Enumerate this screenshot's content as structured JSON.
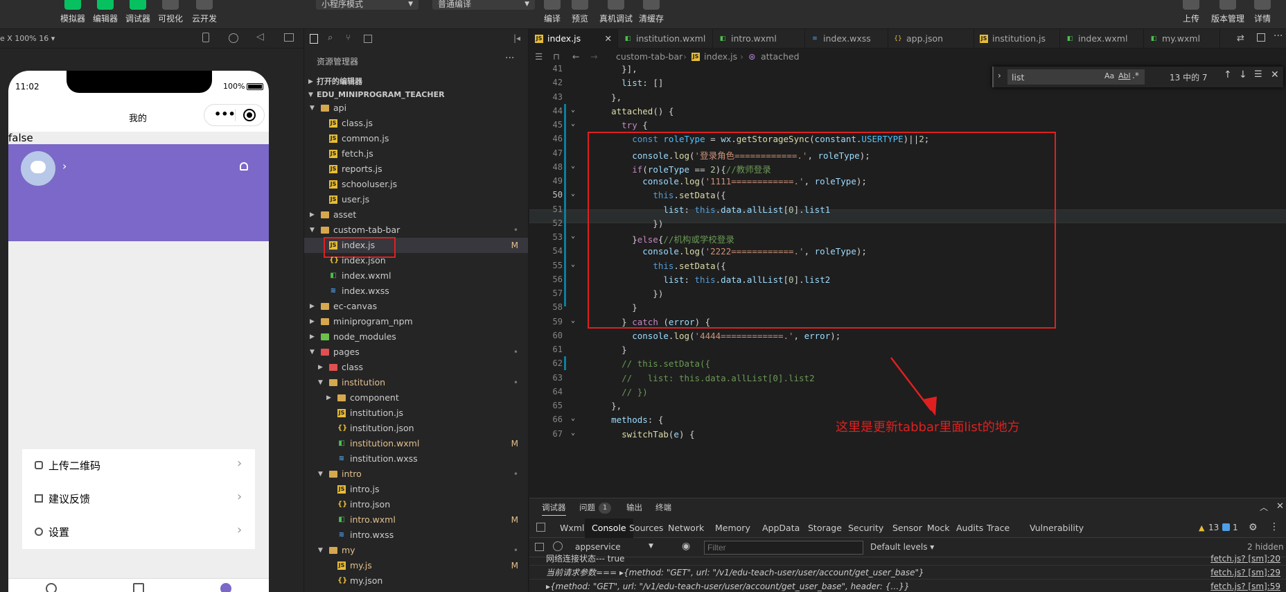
{
  "toolbar": {
    "buttons": [
      "模拟器",
      "编辑器",
      "调试器",
      "可视化",
      "云开发"
    ],
    "mode_select": "小程序模式",
    "compile_select": "普通编译",
    "actions": [
      "编译",
      "预览",
      "真机调试",
      "清缓存"
    ],
    "right_actions": [
      "上传",
      "版本管理",
      "详情"
    ]
  },
  "simulator": {
    "device_label": "e X 100% 16 ▾",
    "time": "11:02",
    "battery": "100%",
    "page_title": "我的",
    "debug_text": "false",
    "menu": [
      "上传二维码",
      "建议反馈",
      "设置"
    ]
  },
  "explorer": {
    "title": "资源管理器",
    "open_editors": "打开的编辑器",
    "project": "EDU_MINIPROGRAM_TEACHER",
    "tree": [
      {
        "name": "api",
        "type": "folder",
        "depth": 1,
        "open": true
      },
      {
        "name": "class.js",
        "type": "js",
        "depth": 2
      },
      {
        "name": "common.js",
        "type": "js",
        "depth": 2
      },
      {
        "name": "fetch.js",
        "type": "js",
        "depth": 2
      },
      {
        "name": "reports.js",
        "type": "js",
        "depth": 2
      },
      {
        "name": "schooluser.js",
        "type": "js",
        "depth": 2
      },
      {
        "name": "user.js",
        "type": "js",
        "depth": 2
      },
      {
        "name": "asset",
        "type": "folder",
        "depth": 1,
        "open": false
      },
      {
        "name": "custom-tab-bar",
        "type": "folder",
        "depth": 1,
        "open": true,
        "status": "•"
      },
      {
        "name": "index.js",
        "type": "js",
        "depth": 2,
        "status": "M",
        "selected": true
      },
      {
        "name": "index.json",
        "type": "json",
        "depth": 2
      },
      {
        "name": "index.wxml",
        "type": "wxml",
        "depth": 2
      },
      {
        "name": "index.wxss",
        "type": "wxss",
        "depth": 2
      },
      {
        "name": "ec-canvas",
        "type": "folder",
        "depth": 1,
        "open": false
      },
      {
        "name": "miniprogram_npm",
        "type": "folder",
        "depth": 1,
        "open": false
      },
      {
        "name": "node_modules",
        "type": "folder-green",
        "depth": 1,
        "open": false
      },
      {
        "name": "pages",
        "type": "folder-red",
        "depth": 1,
        "open": true,
        "status": "•"
      },
      {
        "name": "class",
        "type": "folder-red",
        "depth": 2,
        "open": false
      },
      {
        "name": "institution",
        "type": "folder",
        "depth": 2,
        "open": true,
        "status": "•",
        "color": "#e2c08d"
      },
      {
        "name": "component",
        "type": "folder",
        "depth": 3,
        "open": false
      },
      {
        "name": "institution.js",
        "type": "js",
        "depth": 3
      },
      {
        "name": "institution.json",
        "type": "json",
        "depth": 3
      },
      {
        "name": "institution.wxml",
        "type": "wxml",
        "depth": 3,
        "status": "M",
        "color": "#e2c08d"
      },
      {
        "name": "institution.wxss",
        "type": "wxss",
        "depth": 3
      },
      {
        "name": "intro",
        "type": "folder",
        "depth": 2,
        "open": true,
        "status": "•",
        "color": "#e2c08d"
      },
      {
        "name": "intro.js",
        "type": "js",
        "depth": 3
      },
      {
        "name": "intro.json",
        "type": "json",
        "depth": 3
      },
      {
        "name": "intro.wxml",
        "type": "wxml",
        "depth": 3,
        "status": "M",
        "color": "#e2c08d"
      },
      {
        "name": "intro.wxss",
        "type": "wxss",
        "depth": 3
      },
      {
        "name": "my",
        "type": "folder",
        "depth": 2,
        "open": true,
        "status": "•",
        "color": "#e2c08d"
      },
      {
        "name": "my.js",
        "type": "js",
        "depth": 3,
        "status": "M",
        "color": "#e2c08d"
      },
      {
        "name": "my.json",
        "type": "json",
        "depth": 3
      }
    ]
  },
  "tabs": [
    {
      "label": "index.js",
      "type": "js",
      "active": true
    },
    {
      "label": "institution.wxml",
      "type": "wxml"
    },
    {
      "label": "intro.wxml",
      "type": "wxml"
    },
    {
      "label": "index.wxss",
      "type": "wxss"
    },
    {
      "label": "app.json",
      "type": "json"
    },
    {
      "label": "institution.js",
      "type": "js"
    },
    {
      "label": "index.wxml",
      "type": "wxml"
    },
    {
      "label": "my.wxml",
      "type": "wxml"
    }
  ],
  "breadcrumb": [
    "custom-tab-bar",
    "index.js",
    "attached"
  ],
  "find": {
    "query": "list",
    "result": "13 中的 7",
    "opt_case": "Aa",
    "opt_word": "Abl"
  },
  "code": [
    {
      "n": "41",
      "html": "      }],"
    },
    {
      "n": "42",
      "html": "      <span class=\"var\">list</span>: []"
    },
    {
      "n": "43",
      "html": "    },"
    },
    {
      "n": "44",
      "html": "    <span class=\"fn\">attached</span>() {"
    },
    {
      "n": "45",
      "html": "      <span class=\"pr\">try</span> {"
    },
    {
      "n": "46",
      "html": "        <span class=\"kw\">const</span> <span class=\"cn\">roleType</span> = <span class=\"var\">wx</span>.<span class=\"fn\">getStorageSync</span>(<span class=\"var\">constant</span>.<span class=\"cn\">USERTYPE</span>)||<span class=\"num\">2</span>;"
    },
    {
      "n": "47",
      "html": "        <span class=\"var\">console</span>.<span class=\"fn\">log</span>(<span class=\"str\">'登录角色============.'</span>, <span class=\"var\">roleType</span>);"
    },
    {
      "n": "48",
      "html": "        <span class=\"pr\">if</span>(<span class=\"var\">roleType</span> == <span class=\"num\">2</span>){<span class=\"cm\">//教师登录</span>"
    },
    {
      "n": "49",
      "html": "          <span class=\"var\">console</span>.<span class=\"fn\">log</span>(<span class=\"str\">'1111============.'</span>, <span class=\"var\">roleType</span>);"
    },
    {
      "n": "50",
      "html": "            <span class=\"kw\">this</span>.<span class=\"fn\">setData</span>({"
    },
    {
      "n": "51",
      "html": "              <span class=\"var\">list</span>: <span class=\"kw\">this</span>.<span class=\"var\">data</span>.<span class=\"var\">allList</span>[<span class=\"num\">0</span>].<span class=\"var\">list1</span>"
    },
    {
      "n": "52",
      "html": "            })"
    },
    {
      "n": "53",
      "html": "        }<span class=\"pr\">else</span>{<span class=\"cm\">//机构或学校登录</span>"
    },
    {
      "n": "54",
      "html": "          <span class=\"var\">console</span>.<span class=\"fn\">log</span>(<span class=\"str\">'2222============.'</span>, <span class=\"var\">roleType</span>);"
    },
    {
      "n": "55",
      "html": "            <span class=\"kw\">this</span>.<span class=\"fn\">setData</span>({"
    },
    {
      "n": "56",
      "html": "              <span class=\"var\">list</span>: <span class=\"kw\">this</span>.<span class=\"var\">data</span>.<span class=\"var\">allList</span>[<span class=\"num\">0</span>].<span class=\"var\">list2</span>"
    },
    {
      "n": "57",
      "html": "            })"
    },
    {
      "n": "58",
      "html": "        }"
    },
    {
      "n": "59",
      "html": "      } <span class=\"pr\">catch</span> (<span class=\"var\">error</span>) {"
    },
    {
      "n": "60",
      "html": "        <span class=\"var\">console</span>.<span class=\"fn\">log</span>(<span class=\"str\">'4444============.'</span>, <span class=\"var\">error</span>);"
    },
    {
      "n": "61",
      "html": "      }"
    },
    {
      "n": "62",
      "html": "      <span class=\"cm\">// this.setData({</span>"
    },
    {
      "n": "63",
      "html": "      <span class=\"cm\">//   list: this.data.allList[0].list2</span>"
    },
    {
      "n": "64",
      "html": "      <span class=\"cm\">// })</span>"
    },
    {
      "n": "65",
      "html": "    },"
    },
    {
      "n": "66",
      "html": "    <span class=\"var\">methods</span>: {"
    },
    {
      "n": "67",
      "html": "      <span class=\"fn\">switchTab</span>(<span class=\"var\">e</span>) {"
    }
  ],
  "annotation": "这里是更新tabbar里面list的地方",
  "devtools": {
    "top_tabs": [
      "调试器",
      "问题",
      "输出",
      "终端"
    ],
    "problem_count": "1",
    "tabs": [
      "Wxml",
      "Console",
      "Sources",
      "Network",
      "Memory",
      "AppData",
      "Storage",
      "Security",
      "Sensor",
      "Mock",
      "Audits",
      "Trace",
      "Vulnerability"
    ],
    "warn_count": "13",
    "info_count": "1",
    "context": "appservice",
    "filter_placeholder": "Filter",
    "levels": "Default levels ▾",
    "hidden": "2 hidden",
    "console": [
      {
        "text": "网络连接状态--- true",
        "src": "fetch.js? [sm]:20"
      },
      {
        "text": "当前请求参数=== ▸{method: \"GET\", url: \"/v1/edu-teach-user/user/account/get_user_base\"}",
        "src": "fetch.js? [sm]:29"
      },
      {
        "text": "▸{method: \"GET\", url: \"/v1/edu-teach-user/user/account/get_user_base\", header: {…}}",
        "src": "fetch.js? [sm]:59"
      }
    ]
  },
  "colors": {
    "accent": "#07c160",
    "purple": "#7b68c8",
    "annotation_red": "#e02020"
  }
}
